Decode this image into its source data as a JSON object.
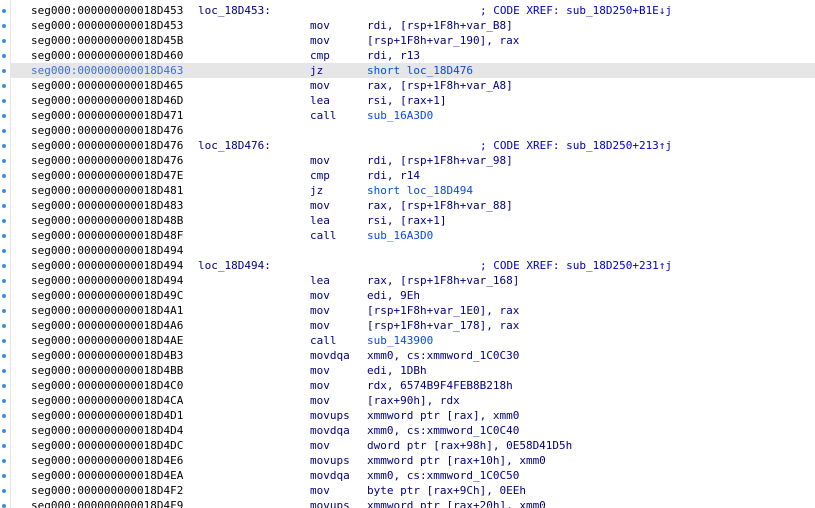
{
  "disasm": {
    "lines": [
      {
        "addr": "seg000:000000000018D453",
        "label": "loc_18D453:",
        "mnemonic": "",
        "operands": "",
        "comment": "; CODE XREF: sub_18D250+B1E↓j",
        "selected": false
      },
      {
        "addr": "seg000:000000000018D453",
        "label": "",
        "mnemonic": "mov",
        "operands": "rdi, [rsp+1F8h+var_B8]",
        "comment": "",
        "selected": false
      },
      {
        "addr": "seg000:000000000018D45B",
        "label": "",
        "mnemonic": "mov",
        "operands": "[rsp+1F8h+var_190], rax",
        "comment": "",
        "selected": false
      },
      {
        "addr": "seg000:000000000018D460",
        "label": "",
        "mnemonic": "cmp",
        "operands": "rdi, r13",
        "comment": "",
        "selected": false
      },
      {
        "addr": "seg000:000000000018D463",
        "label": "",
        "mnemonic": "jz",
        "operands": "short loc_18D476",
        "comment": "",
        "selected": true
      },
      {
        "addr": "seg000:000000000018D465",
        "label": "",
        "mnemonic": "mov",
        "operands": "rax, [rsp+1F8h+var_A8]",
        "comment": "",
        "selected": false
      },
      {
        "addr": "seg000:000000000018D46D",
        "label": "",
        "mnemonic": "lea",
        "operands": "rsi, [rax+1]",
        "comment": "",
        "selected": false
      },
      {
        "addr": "seg000:000000000018D471",
        "label": "",
        "mnemonic": "call",
        "operands": "sub_16A3D0",
        "comment": "",
        "selected": false
      },
      {
        "addr": "seg000:000000000018D476",
        "label": "",
        "mnemonic": "",
        "operands": "",
        "comment": "",
        "selected": false
      },
      {
        "addr": "seg000:000000000018D476",
        "label": "loc_18D476:",
        "mnemonic": "",
        "operands": "",
        "comment": "; CODE XREF: sub_18D250+213↑j",
        "selected": false
      },
      {
        "addr": "seg000:000000000018D476",
        "label": "",
        "mnemonic": "mov",
        "operands": "rdi, [rsp+1F8h+var_98]",
        "comment": "",
        "selected": false
      },
      {
        "addr": "seg000:000000000018D47E",
        "label": "",
        "mnemonic": "cmp",
        "operands": "rdi, r14",
        "comment": "",
        "selected": false
      },
      {
        "addr": "seg000:000000000018D481",
        "label": "",
        "mnemonic": "jz",
        "operands": "short loc_18D494",
        "comment": "",
        "selected": false
      },
      {
        "addr": "seg000:000000000018D483",
        "label": "",
        "mnemonic": "mov",
        "operands": "rax, [rsp+1F8h+var_88]",
        "comment": "",
        "selected": false
      },
      {
        "addr": "seg000:000000000018D48B",
        "label": "",
        "mnemonic": "lea",
        "operands": "rsi, [rax+1]",
        "comment": "",
        "selected": false
      },
      {
        "addr": "seg000:000000000018D48F",
        "label": "",
        "mnemonic": "call",
        "operands": "sub_16A3D0",
        "comment": "",
        "selected": false
      },
      {
        "addr": "seg000:000000000018D494",
        "label": "",
        "mnemonic": "",
        "operands": "",
        "comment": "",
        "selected": false
      },
      {
        "addr": "seg000:000000000018D494",
        "label": "loc_18D494:",
        "mnemonic": "",
        "operands": "",
        "comment": "; CODE XREF: sub_18D250+231↑j",
        "selected": false
      },
      {
        "addr": "seg000:000000000018D494",
        "label": "",
        "mnemonic": "lea",
        "operands": "rax, [rsp+1F8h+var_168]",
        "comment": "",
        "selected": false
      },
      {
        "addr": "seg000:000000000018D49C",
        "label": "",
        "mnemonic": "mov",
        "operands": "edi, 9Eh",
        "comment": "",
        "selected": false
      },
      {
        "addr": "seg000:000000000018D4A1",
        "label": "",
        "mnemonic": "mov",
        "operands": "[rsp+1F8h+var_1E0], rax",
        "comment": "",
        "selected": false
      },
      {
        "addr": "seg000:000000000018D4A6",
        "label": "",
        "mnemonic": "mov",
        "operands": "[rsp+1F8h+var_178], rax",
        "comment": "",
        "selected": false
      },
      {
        "addr": "seg000:000000000018D4AE",
        "label": "",
        "mnemonic": "call",
        "operands": "sub_143900",
        "comment": "",
        "selected": false
      },
      {
        "addr": "seg000:000000000018D4B3",
        "label": "",
        "mnemonic": "movdqa",
        "operands": "xmm0, cs:xmmword_1C0C30",
        "comment": "",
        "selected": false
      },
      {
        "addr": "seg000:000000000018D4BB",
        "label": "",
        "mnemonic": "mov",
        "operands": "edi, 1DBh",
        "comment": "",
        "selected": false
      },
      {
        "addr": "seg000:000000000018D4C0",
        "label": "",
        "mnemonic": "mov",
        "operands": "rdx, 6574B9F4FEB8B218h",
        "comment": "",
        "selected": false
      },
      {
        "addr": "seg000:000000000018D4CA",
        "label": "",
        "mnemonic": "mov",
        "operands": "[rax+90h], rdx",
        "comment": "",
        "selected": false
      },
      {
        "addr": "seg000:000000000018D4D1",
        "label": "",
        "mnemonic": "movups",
        "operands": "xmmword ptr [rax], xmm0",
        "comment": "",
        "selected": false
      },
      {
        "addr": "seg000:000000000018D4D4",
        "label": "",
        "mnemonic": "movdqa",
        "operands": "xmm0, cs:xmmword_1C0C40",
        "comment": "",
        "selected": false
      },
      {
        "addr": "seg000:000000000018D4DC",
        "label": "",
        "mnemonic": "mov",
        "operands": "dword ptr [rax+98h], 0E58D41D5h",
        "comment": "",
        "selected": false
      },
      {
        "addr": "seg000:000000000018D4E6",
        "label": "",
        "mnemonic": "movups",
        "operands": "xmmword ptr [rax+10h], xmm0",
        "comment": "",
        "selected": false
      },
      {
        "addr": "seg000:000000000018D4EA",
        "label": "",
        "mnemonic": "movdqa",
        "operands": "xmm0, cs:xmmword_1C0C50",
        "comment": "",
        "selected": false
      },
      {
        "addr": "seg000:000000000018D4F2",
        "label": "",
        "mnemonic": "mov",
        "operands": "byte ptr [rax+9Ch], 0EEh",
        "comment": "",
        "selected": false
      },
      {
        "addr": "seg000:000000000018D4F9",
        "label": "",
        "mnemonic": "movups",
        "operands": "xmmword ptr [rax+20h], xmm0",
        "comment": "",
        "selected": false
      }
    ]
  },
  "colors": {
    "address": "#000000",
    "instruction": "#000080",
    "comment": "#0000c0",
    "selection": "#e6e6e6",
    "gutter_marker": "#3d8fe0"
  },
  "icons": {
    "gutter_marker": "breakpoint-dot-icon"
  }
}
